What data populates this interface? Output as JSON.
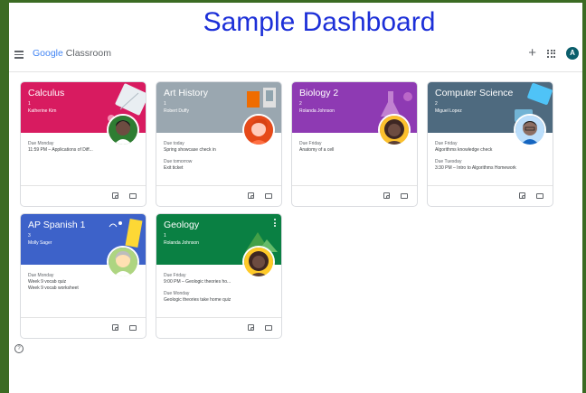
{
  "banner": {
    "title": "Sample Dashboard"
  },
  "app": {
    "brand_google": "Google",
    "brand_product": "Classroom",
    "account_initial": "A"
  },
  "icons": {
    "menu": "hamburger-icon",
    "add": "plus-icon",
    "apps": "apps-grid-icon",
    "assignments": "assignment-icon",
    "folder": "folder-icon",
    "help": "help-icon"
  },
  "classes": [
    {
      "title": "Calculus",
      "section": "1",
      "teacher": "Katherine Kim",
      "color": "#d81b60",
      "due": [
        {
          "label": "Due Monday",
          "item": "11:59 PM – Applications of Diff..."
        }
      ]
    },
    {
      "title": "Art History",
      "section": "1",
      "teacher": "Robert Duffy",
      "color": "#9aa7b0",
      "due": [
        {
          "label": "Due today",
          "item": "Spring showcase check in"
        },
        {
          "label": "Due tomorrow",
          "item": "Exit ticket"
        }
      ]
    },
    {
      "title": "Biology 2",
      "section": "2",
      "teacher": "Rolanda Johnson",
      "color": "#8e3ab3",
      "due": [
        {
          "label": "Due Friday",
          "item": "Anatomy of a cell"
        }
      ]
    },
    {
      "title": "Computer Science",
      "section": "2",
      "teacher": "Miguel Lopez",
      "color": "#4e6a7f",
      "due": [
        {
          "label": "Due Friday",
          "item": "Algorithms knowledge check"
        },
        {
          "label": "Due Tuesday",
          "item": "3:30 PM – Intro to Algorithms Homework"
        }
      ]
    },
    {
      "title": "AP Spanish 1",
      "section": "3",
      "teacher": "Molly Sager",
      "color": "#3d62c9",
      "due": [
        {
          "label": "Due Monday",
          "item": "Week 9 vocab quiz",
          "item2": "Week 9 vocab worksheet"
        }
      ]
    },
    {
      "title": "Geology",
      "section": "1",
      "teacher": "Rolanda Johnson",
      "color": "#0a8043",
      "due": [
        {
          "label": "Due Friday",
          "item": "9:00 PM – Geologic theories ho..."
        },
        {
          "label": "Due Monday",
          "item": "Geologic theories take home quiz"
        }
      ]
    }
  ]
}
